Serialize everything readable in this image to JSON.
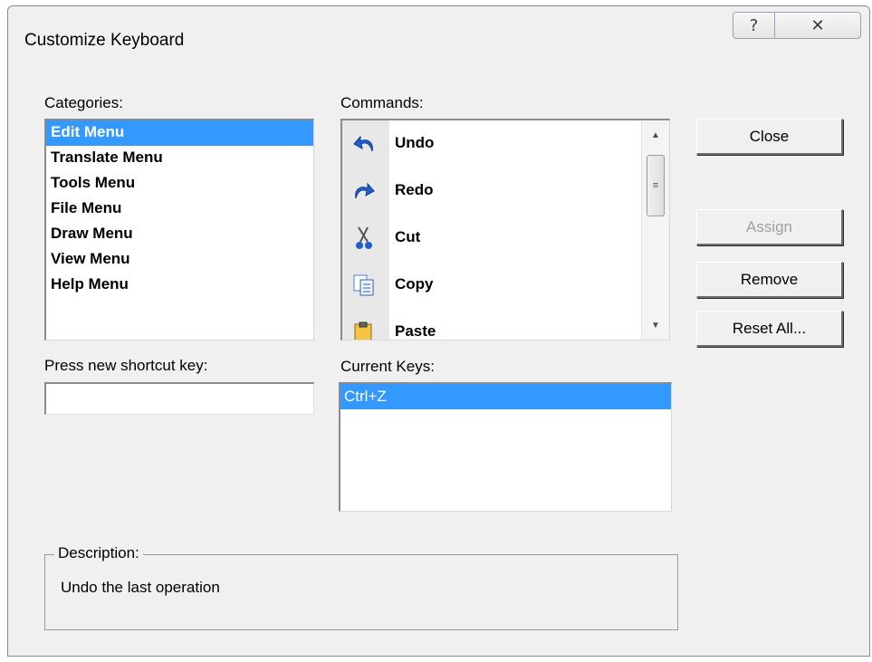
{
  "window": {
    "title": "Customize Keyboard",
    "help_glyph": "?",
    "close_glyph": "✕"
  },
  "categories": {
    "label": "Categories:",
    "items": [
      {
        "label": "Edit Menu",
        "selected": true
      },
      {
        "label": "Translate Menu",
        "selected": false
      },
      {
        "label": "Tools Menu",
        "selected": false
      },
      {
        "label": "File Menu",
        "selected": false
      },
      {
        "label": "Draw Menu",
        "selected": false
      },
      {
        "label": "View Menu",
        "selected": false
      },
      {
        "label": "Help Menu",
        "selected": false
      }
    ]
  },
  "commands": {
    "label": "Commands:",
    "items": [
      {
        "label": "Undo",
        "icon": "undo-icon"
      },
      {
        "label": "Redo",
        "icon": "redo-icon"
      },
      {
        "label": "Cut",
        "icon": "cut-icon"
      },
      {
        "label": "Copy",
        "icon": "copy-icon"
      },
      {
        "label": "Paste",
        "icon": "paste-icon"
      }
    ]
  },
  "shortcut": {
    "label": "Press new shortcut key:",
    "value": ""
  },
  "current_keys": {
    "label": "Current Keys:",
    "items": [
      {
        "label": "Ctrl+Z",
        "selected": true
      }
    ]
  },
  "buttons": {
    "close": "Close",
    "assign": "Assign",
    "remove": "Remove",
    "reset_all": "Reset All..."
  },
  "description": {
    "legend": "Description:",
    "text": "Undo the last operation"
  },
  "colors": {
    "selection": "#3399ff",
    "dialog_bg": "#f0f0f0",
    "icon_blue": "#1f5fd0"
  }
}
